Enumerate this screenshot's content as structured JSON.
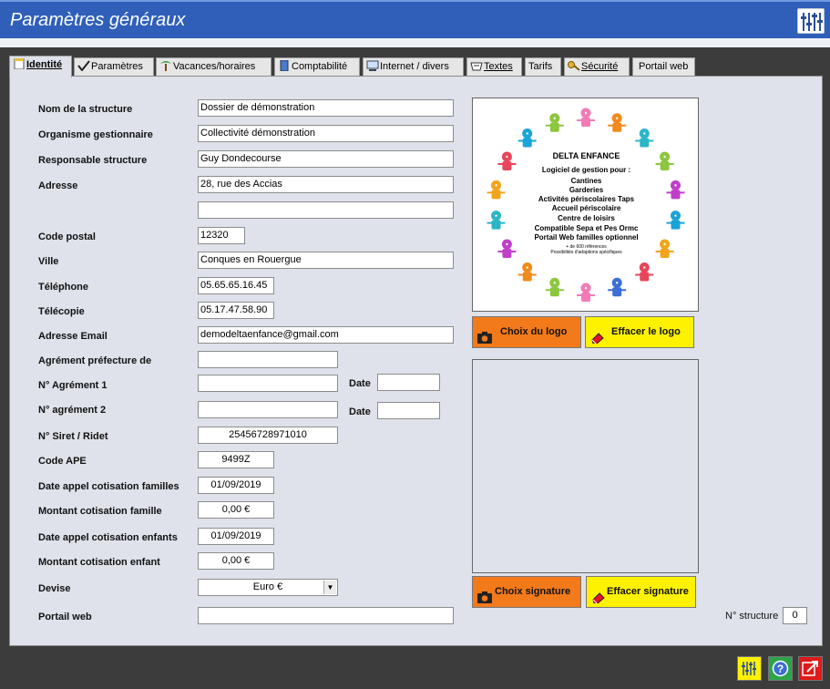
{
  "window": {
    "title": "Paramètres généraux",
    "title_icon": "mixer-icon"
  },
  "tabs": [
    {
      "label": "Identité",
      "icon": "document-icon",
      "active": true
    },
    {
      "label": "Paramètres",
      "icon": "checkmark-icon"
    },
    {
      "label": "Vacances/horaires",
      "icon": "palm-tree-icon"
    },
    {
      "label": "Comptabilité",
      "icon": "ledger-icon"
    },
    {
      "label": "Internet / divers",
      "icon": "computer-icon"
    },
    {
      "label": "Textes",
      "icon": "text-icon"
    },
    {
      "label": "Tarifs",
      "icon": ""
    },
    {
      "label": "Sécurité",
      "icon": "key-icon"
    },
    {
      "label": "Portail web",
      "icon": ""
    }
  ],
  "form": {
    "nom_structure": {
      "label": "Nom de la structure",
      "value": "Dossier de démonstration"
    },
    "organisme": {
      "label": "Organisme gestionnaire",
      "value": "Collectivité démonstration"
    },
    "responsable": {
      "label": "Responsable structure",
      "value": "Guy Dondecourse"
    },
    "adresse": {
      "label": "Adresse",
      "value": "28, rue des Accias",
      "value2": ""
    },
    "code_postal": {
      "label": "Code postal",
      "value": "12320"
    },
    "ville": {
      "label": "Ville",
      "value": "Conques en Rouergue"
    },
    "telephone": {
      "label": "Téléphone",
      "value": "05.65.65.16.45"
    },
    "telecopie": {
      "label": "Télécopie",
      "value": "05.17.47.58.90"
    },
    "email": {
      "label": "Adresse Email",
      "value": "demodeltaenfance@gmail.com"
    },
    "agrement_prefecture": {
      "label": "Agrément préfecture de",
      "value": ""
    },
    "agrement1": {
      "label": "N° Agrément 1",
      "value": "",
      "date_label": "Date",
      "date": ""
    },
    "agrement2": {
      "label": "N° agrément 2",
      "value": "",
      "date_label": "Date",
      "date": ""
    },
    "siret": {
      "label": "N° Siret / Ridet",
      "value": "25456728971010"
    },
    "ape": {
      "label": "Code APE",
      "value": "9499Z"
    },
    "date_cot_familles": {
      "label": "Date appel cotisation familles",
      "value": "01/09/2019"
    },
    "montant_cot_famille": {
      "label": "Montant cotisation famille",
      "value": "0,00 €"
    },
    "date_cot_enfants": {
      "label": "Date appel cotisation enfants",
      "value": "01/09/2019"
    },
    "montant_cot_enfant": {
      "label": "Montant cotisation enfant",
      "value": "0,00 €"
    },
    "devise": {
      "label": "Devise",
      "value": "Euro €"
    },
    "portail": {
      "label": "Portail web",
      "value": ""
    }
  },
  "logo": {
    "lines": [
      {
        "text": "DELTA ENFANCE",
        "color": "#1f3fbf"
      },
      {
        "text": "Logiciel de gestion pour :",
        "color": "#1f3fbf"
      },
      {
        "text": "Cantines",
        "color": "#1aa3d9"
      },
      {
        "text": "Garderies",
        "color": "#f08a1c"
      },
      {
        "text": "Activités périscolaires Taps",
        "color": "#2bb5c8"
      },
      {
        "text": "Accueil périscolaire",
        "color": "#c03fc9"
      },
      {
        "text": "Centre de loisirs",
        "color": "#f27bb7"
      },
      {
        "text": "Compatible Sepa et Pes Ormc",
        "color": "#f0a51c"
      },
      {
        "text": "Portail Web familles optionnel",
        "color": "#8dc63f"
      },
      {
        "text": "+ de 600 références",
        "color": "#1f3fbf"
      },
      {
        "text": "Possibilités d'adaptions spécifiques",
        "color": "#1f3fbf"
      }
    ]
  },
  "buttons": {
    "choix_logo": "Choix du logo",
    "effacer_logo": "Effacer le logo",
    "choix_signature": "Choix signature",
    "effacer_signature": "Effacer signature"
  },
  "structure": {
    "label": "N° structure",
    "value": "0"
  },
  "footer": {
    "icons": [
      "mixer-icon",
      "help-icon",
      "exit-icon"
    ]
  },
  "colors": {
    "titlebar": "#2f5fb8",
    "panel": "#dfe2ea",
    "orange_button": "#f37a1b",
    "yellow_button": "#fff200"
  }
}
